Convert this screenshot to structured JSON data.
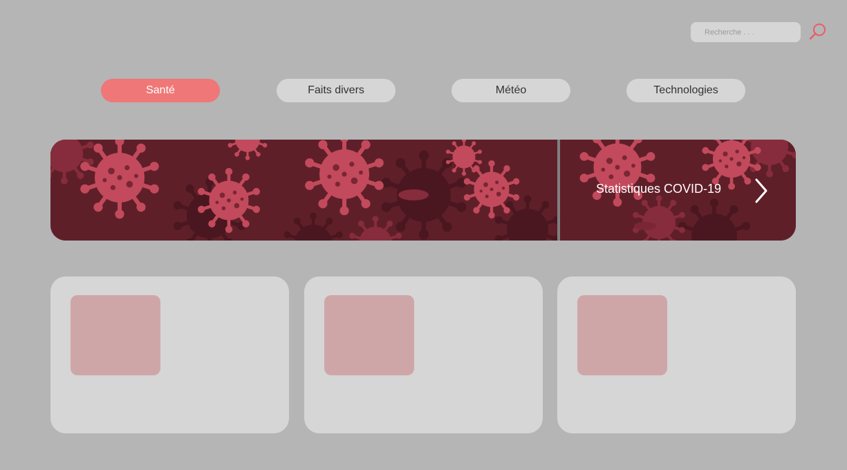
{
  "search": {
    "placeholder": "Recherche . . ."
  },
  "icons": {
    "search": "search-icon",
    "next": "chevron-right-icon",
    "virus": "virus-icon"
  },
  "colors": {
    "background": "#b5b5b5",
    "accent": "#ef7777",
    "pill": "#d6d6d6",
    "banner_dark": "#5f1f29",
    "virus": "#c24a5c",
    "thumb": "#cfa6a8"
  },
  "tabs": [
    {
      "label": "Santé",
      "active": true
    },
    {
      "label": "Faits divers",
      "active": false
    },
    {
      "label": "Météo",
      "active": false
    },
    {
      "label": "Technologies",
      "active": false
    }
  ],
  "banner": {
    "title": "Statistiques COVID-19"
  },
  "cards": [
    {},
    {},
    {}
  ]
}
